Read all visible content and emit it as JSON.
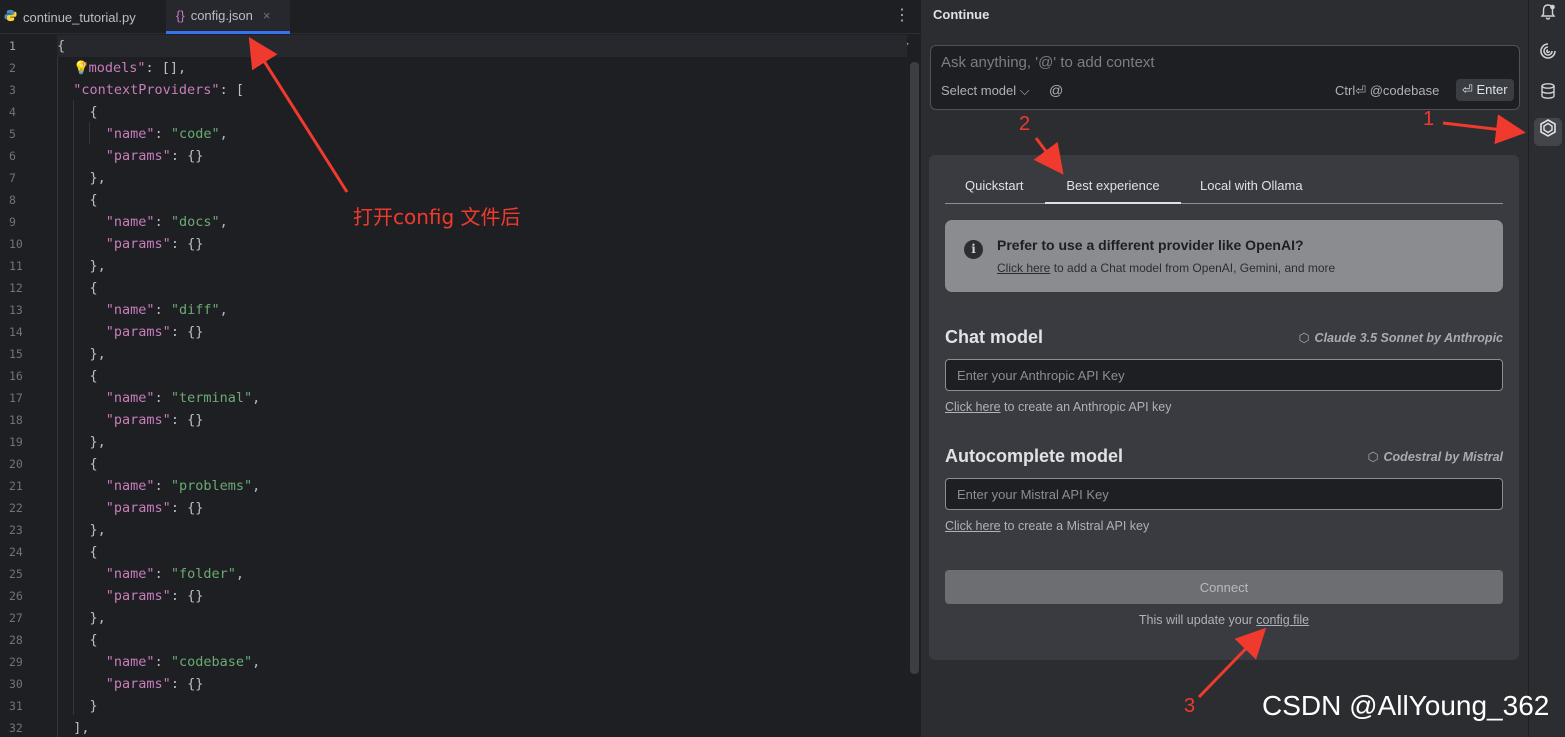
{
  "editor": {
    "tabs": [
      {
        "label": "continue_tutorial.py",
        "icon": "python-icon"
      },
      {
        "label": "config.json",
        "icon": "json-braces-icon",
        "active": true
      }
    ],
    "line_numbers": [
      "1",
      "2",
      "3",
      "4",
      "5",
      "6",
      "7",
      "8",
      "9",
      "10",
      "11",
      "12",
      "13",
      "14",
      "15",
      "16",
      "17",
      "18",
      "19",
      "20",
      "21",
      "22",
      "23",
      "24",
      "25",
      "26",
      "27",
      "28",
      "29",
      "30",
      "31",
      "32"
    ],
    "code": {
      "l1": "{",
      "models_key": "\"models\"",
      "models_val": ": [],",
      "cp_key": "\"contextProviders\"",
      "cp_val": ": [",
      "open": "{",
      "close": "},",
      "close_last": "}",
      "name_key": "\"name\"",
      "params_key": "\"params\"",
      "params_val": ": {}",
      "colon": ": ",
      "comma": ",",
      "bracket_close": "],",
      "names": [
        "\"code\"",
        "\"docs\"",
        "\"diff\"",
        "\"terminal\"",
        "\"problems\"",
        "\"folder\"",
        "\"codebase\""
      ]
    },
    "annotation": "打开config 文件后"
  },
  "panel": {
    "title": "Continue",
    "input_placeholder": "Ask anything, '@' to add context",
    "select_model": "Select model",
    "at_symbol": "@",
    "ctrl_codebase": "Ctrl⏎ @codebase",
    "enter": "⏎ Enter",
    "tabs": [
      "Quickstart",
      "Best experience",
      "Local with Ollama"
    ],
    "notice": {
      "title": "Prefer to use a different provider like OpenAI?",
      "link": "Click here",
      "rest": " to add a Chat model from OpenAI, Gemini, and more"
    },
    "chat": {
      "title": "Chat model",
      "model": "Claude 3.5 Sonnet by Anthropic",
      "placeholder": "Enter your Anthropic API Key",
      "link": "Click here",
      "rest": " to create an Anthropic API key"
    },
    "autocomplete": {
      "title": "Autocomplete model",
      "model": "Codestral by Mistral",
      "placeholder": "Enter your Mistral API Key",
      "link": "Click here",
      "rest": " to create a Mistral API key"
    },
    "connect": "Connect",
    "update_prefix": "This will update your ",
    "update_link": "config file"
  },
  "annotations": {
    "n1": "1",
    "n2": "2",
    "n3": "3"
  },
  "watermark": "CSDN @AllYoung_362",
  "colors": {
    "arrow": "#f03a2e",
    "accent": "#3574f0"
  }
}
